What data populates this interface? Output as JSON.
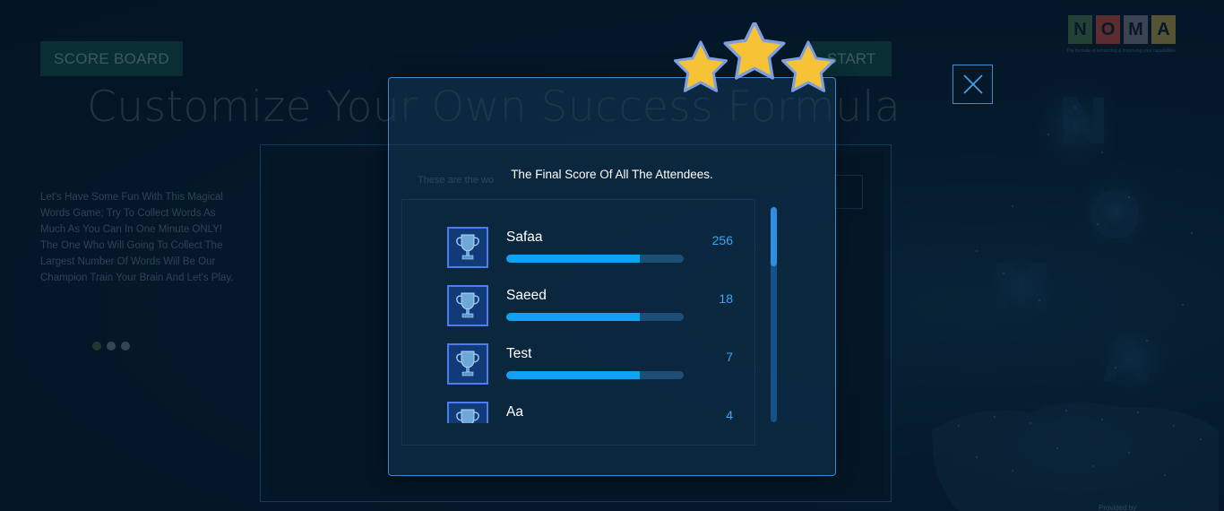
{
  "background": {
    "scoreboard_label": "SCORE BOARD",
    "start_label": "START",
    "title": "Customize Your Own Success Formula",
    "intro": "Let's Have Some Fun With This Magical Words Game; Try To Collect Words As Much As You Can In One Minute ONLY! The One Who Will Going To Collect The Largest Number Of Words Will Be Our Champion Train Your Brain And Let's Play.",
    "carousel": {
      "count": 3,
      "active": 0
    },
    "panel_hint": "These are the wo",
    "provided_by": "Provided by"
  },
  "logo": {
    "letters": [
      "N",
      "O",
      "M",
      "A"
    ],
    "colors": [
      "#3e6e4d",
      "#a5473f",
      "#6c6f80",
      "#9a8c47"
    ],
    "tagline": "The formula of enhancing & improving your capabilities"
  },
  "modal": {
    "title": "The Final Score Of All The Attendees.",
    "stars": 3,
    "star_color": "#f6c236",
    "attendees": [
      {
        "name": "Safaa",
        "score": "256",
        "progress": 0.75
      },
      {
        "name": "Saeed",
        "score": "18",
        "progress": 0.75
      },
      {
        "name": "Test",
        "score": "7",
        "progress": 0.75
      },
      {
        "name": "Aa",
        "score": "4",
        "progress": 0.75
      }
    ]
  },
  "icons": {
    "close": "close-icon",
    "trophy": "trophy-icon",
    "star": "star-icon"
  }
}
